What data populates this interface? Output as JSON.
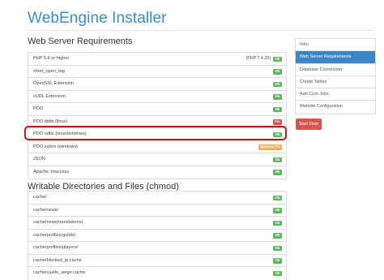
{
  "app": {
    "title": "WebEngine Installer"
  },
  "server_requirements": {
    "heading": "Web Server Requirements",
    "rows": [
      {
        "label": "PHP 5.6 or higher",
        "version": "(PHP 7.4.29)",
        "status": "Ok",
        "status_type": "ok"
      },
      {
        "label": "short_open_tag",
        "status": "Ok",
        "status_type": "ok"
      },
      {
        "label": "OpenSSL Extension",
        "status": "Ok",
        "status_type": "ok"
      },
      {
        "label": "cURL Extension",
        "status": "Ok",
        "status_type": "ok"
      },
      {
        "label": "PDO",
        "status": "Ok",
        "status_type": "ok"
      },
      {
        "label": "PDO dblib (linux)",
        "status": "Fix",
        "status_type": "fix"
      },
      {
        "label": "PDO odbc (linux/windows)",
        "status": "Ok",
        "status_type": "ok"
      },
      {
        "label": "PDO sqlsrv (windows)",
        "status": "Optional Fix",
        "status_type": "opt"
      },
      {
        "label": "JSON",
        "status": "Ok",
        "status_type": "ok"
      },
      {
        "label": "Apache .htaccess",
        "status": "Ok",
        "status_type": "ok"
      }
    ]
  },
  "writable": {
    "heading": "Writable Directories and Files (chmod)",
    "rows": [
      {
        "label": "cache/",
        "status": "Ok"
      },
      {
        "label": "cache/news/",
        "status": "Ok"
      },
      {
        "label": "cache/news/translations/",
        "status": "Ok"
      },
      {
        "label": "cache/profiles/guilds/",
        "status": "Ok"
      },
      {
        "label": "cache/profiles/players/",
        "status": "Ok"
      },
      {
        "label": "cache/blocked_ip.cache",
        "status": "Ok"
      },
      {
        "label": "cache/castle_siege.cache",
        "status": "Ok"
      }
    ]
  },
  "sidebar": {
    "items": [
      {
        "label": "Intro",
        "active": false
      },
      {
        "label": "Web Server Requirements",
        "active": true
      },
      {
        "label": "Database Connection",
        "active": false
      },
      {
        "label": "Create Tables",
        "active": false
      },
      {
        "label": "Add Cron Jobs",
        "active": false
      },
      {
        "label": "Website Configuration",
        "active": false
      }
    ],
    "start_over": "Start Over"
  },
  "colors": {
    "title": "#3a8ed0",
    "ok": "#5cb85c",
    "fix": "#d9534f",
    "optional": "#f0ad4e",
    "active": "#3a87c8",
    "highlight": "#c0171d"
  }
}
